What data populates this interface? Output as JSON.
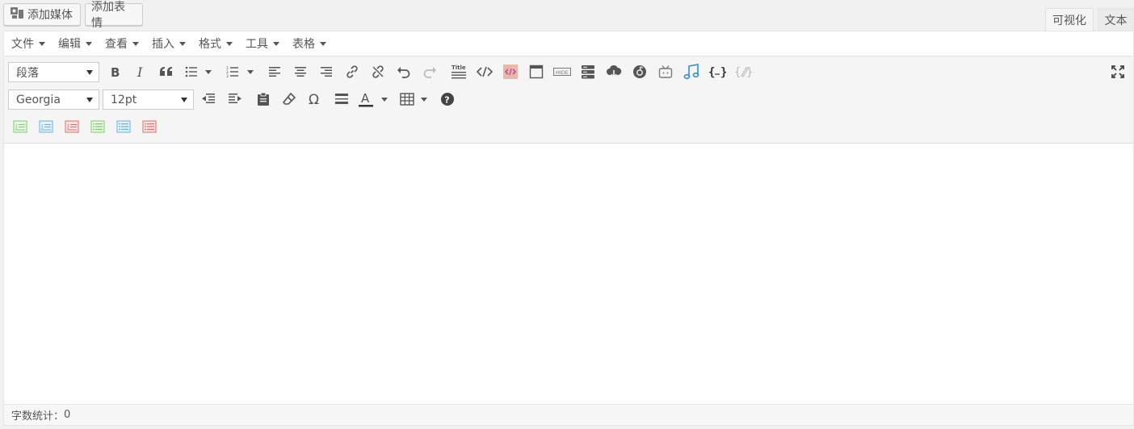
{
  "topbar": {
    "add_media": "添加媒体",
    "add_emoji": "添加表情"
  },
  "modes": {
    "visual": "可视化",
    "text": "文本"
  },
  "menubar": {
    "items": [
      "文件",
      "编辑",
      "查看",
      "插入",
      "格式",
      "工具",
      "表格"
    ]
  },
  "toolbar": {
    "block_format": "段落",
    "font_family": "Georgia",
    "font_size": "12pt",
    "title_icon_label": "Title",
    "hide_icon_label": "HIDE"
  },
  "status": {
    "word_count_label": "字数统计：",
    "word_count": "0"
  }
}
